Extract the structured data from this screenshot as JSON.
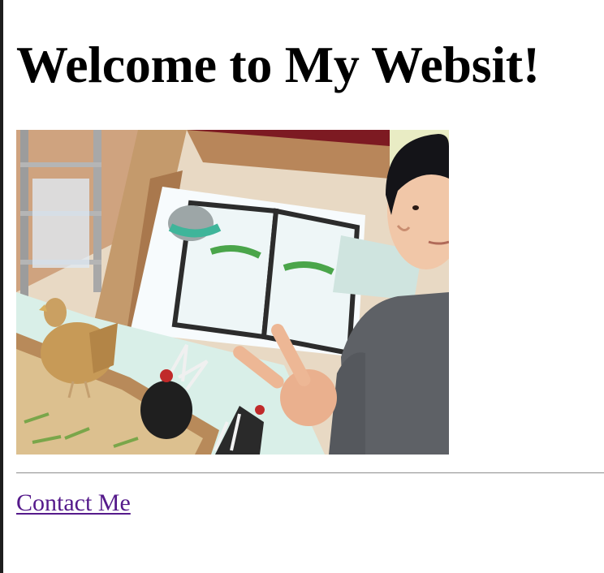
{
  "page": {
    "title": "Welcome to My Websit!"
  },
  "photo": {
    "description_icon": "selfie-photo"
  },
  "links": {
    "contact_label": "Contact Me"
  },
  "colors": {
    "link_visited": "#551a8b",
    "text": "#000000",
    "background": "#ffffff"
  }
}
